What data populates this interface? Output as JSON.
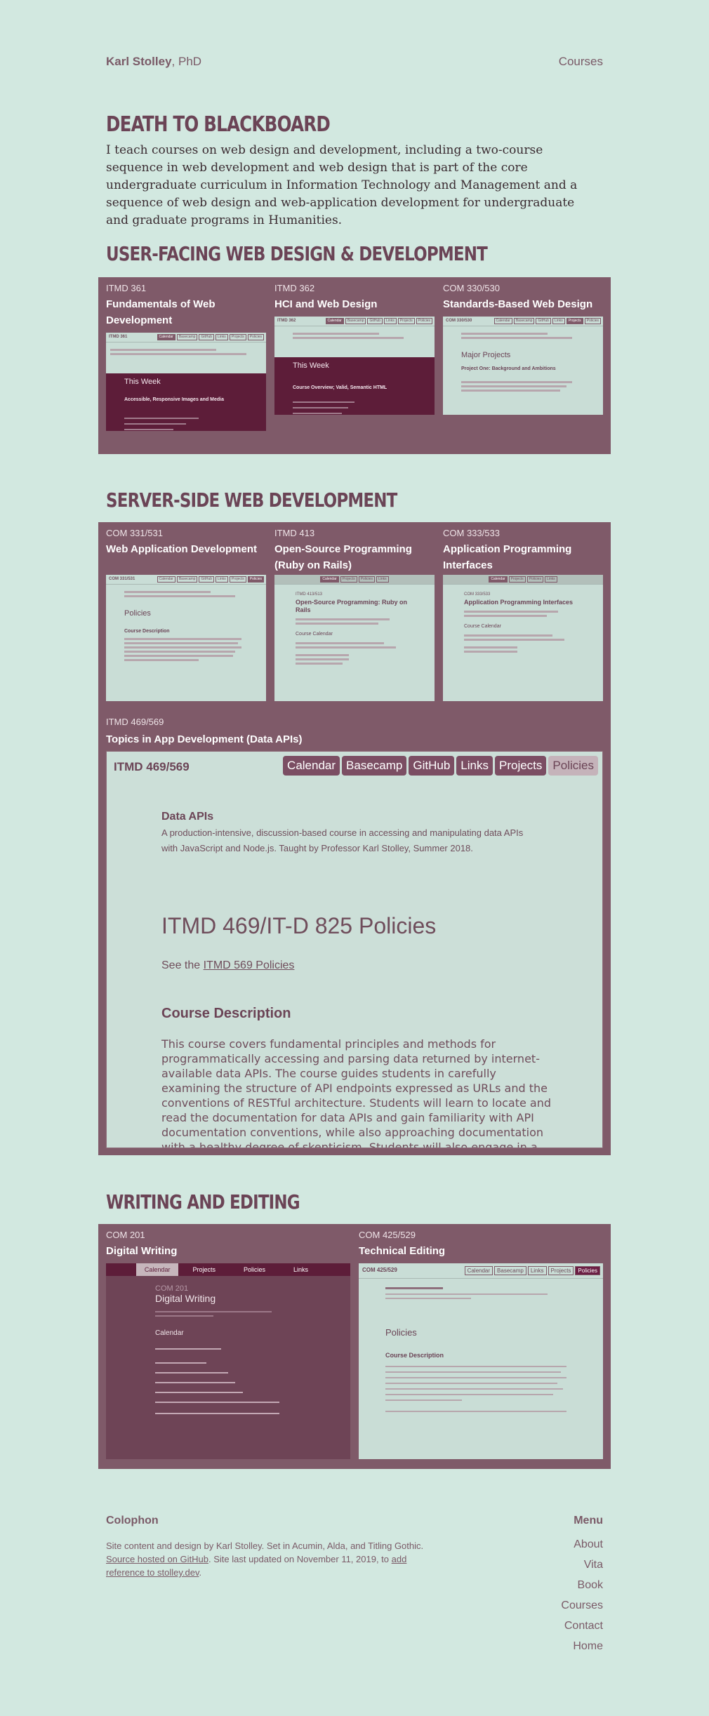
{
  "header": {
    "name": "Karl Stolley",
    "suffix": ", PhD",
    "courses_link": "Courses"
  },
  "hero": {
    "title": "DEATH TO BLACKBOARD",
    "intro": "I teach courses on web design and development, including a two-course sequence in web development and web design that is part of the core undergraduate curriculum in Information Technology and Management and a sequence of web design and web-application development for undergraduate and graduate programs in Humanities."
  },
  "sections": {
    "user_facing": {
      "title": "USER-FACING WEB DESIGN & DEVELOPMENT",
      "cards": [
        {
          "code": "ITMD 361",
          "title": "Fundamentals of Web Development",
          "thumb_logo": "ITMD 361",
          "thumb_heading": "This Week",
          "thumb_sub": "Accessible, Responsive Images and Media"
        },
        {
          "code": "ITMD 362",
          "title": "HCI and Web Design",
          "thumb_logo": "ITMD 362",
          "thumb_heading": "This Week",
          "thumb_sub": "Course Overview; Valid, Semantic HTML"
        },
        {
          "code": "COM 330/530",
          "title": "Standards-Based Web Design",
          "thumb_logo": "COM 330/530",
          "thumb_heading": "Major Projects",
          "thumb_sub": "Project One: Background and Ambitions"
        }
      ]
    },
    "server_side": {
      "title": "SERVER-SIDE WEB DEVELOPMENT",
      "cards": [
        {
          "code": "COM 331/531",
          "title": "Web Application Development",
          "thumb_logo": "COM 331/531",
          "thumb_heading": "Policies",
          "thumb_sub": "Course Description"
        },
        {
          "code": "ITMD 413",
          "title": "Open-Source Programming (Ruby on Rails)",
          "thumb_logo": "ITMD 413/513",
          "thumb_heading": "Open-Source Programming: Ruby on Rails",
          "thumb_sub": "Course Calendar"
        },
        {
          "code": "COM 333/533",
          "title": "Application Programming Interfaces",
          "thumb_logo": "COM 333/533",
          "thumb_heading": "Application Programming Interfaces",
          "thumb_sub": "Course Calendar"
        }
      ],
      "featured": {
        "code": "ITMD 469/569",
        "title": "Topics in App Development (Data APIs)",
        "logo": "ITMD 469/569",
        "nav": [
          "Calendar",
          "Basecamp",
          "GitHub",
          "Links",
          "Projects",
          "Policies"
        ],
        "active_nav": "Policies",
        "subtitle": "Data APIs",
        "description": "A production-intensive, discussion-based course in accessing and manipulating data APIs with JavaScript and Node.js. Taught by Professor Karl Stolley, Summer 2018.",
        "policies_heading": "ITMD 469/IT-D 825 Policies",
        "see_prefix": "See the ",
        "see_link": "ITMD 569 Policies",
        "course_desc_heading": "Course Description",
        "course_desc_text": "This course covers fundamental principles and methods for programmatically accessing and parsing data returned by internet-available data APIs. The course guides students in carefully examining the structure of API endpoints expressed as URLs and the conventions of RESTful architecture. Students will learn to locate and read the documentation for data APIs and gain familiarity with API documentation conventions, while also approaching documentation with a healthy degree of skepticism. Students will also engage in a thorough study of three"
      }
    },
    "writing": {
      "title": "WRITING AND EDITING",
      "cards": [
        {
          "code": "COM 201",
          "title": "Digital Writing",
          "thumb_logo": "COM 201",
          "thumb_heading": "Digital Writing",
          "thumb_sub": "Calendar",
          "nav": [
            "Calendar",
            "Projects",
            "Policies",
            "Links"
          ]
        },
        {
          "code": "COM 425/529",
          "title": "Technical Editing",
          "thumb_logo": "COM 425/529",
          "thumb_heading": "Policies",
          "thumb_sub": "Course Description",
          "nav": [
            "Calendar",
            "Basecamp",
            "Links",
            "Projects",
            "Policies"
          ]
        }
      ]
    }
  },
  "footer": {
    "colophon_heading": "Colophon",
    "colophon_text1": "Site content and design by Karl Stolley. Set in Acumin, Alda, and Titling Gothic.",
    "source_link": "Source hosted on GitHub",
    "colophon_text2": ". Site last updated on November 11, 2019, to ",
    "update_link": "add reference to stolley.dev",
    "colophon_end": ".",
    "menu_heading": "Menu",
    "menu": [
      "About",
      "Vita",
      "Book",
      "Courses",
      "Contact",
      "Home"
    ]
  },
  "colors": {
    "background": "#d2e8e0",
    "panel": "#7f5a69",
    "accent": "#6b4456",
    "dark": "#5d1d39"
  }
}
